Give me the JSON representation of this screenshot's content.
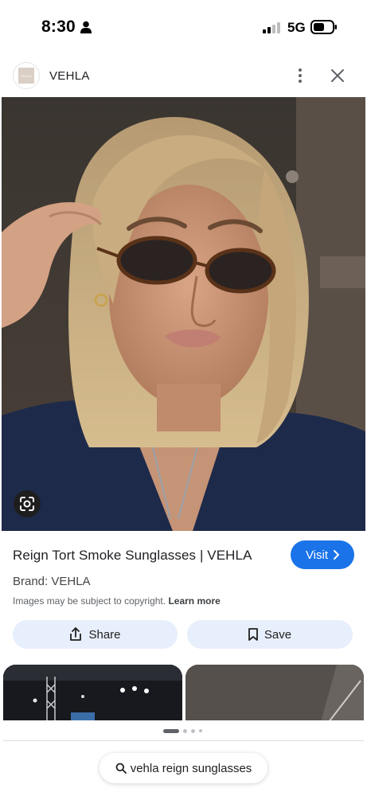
{
  "status_bar": {
    "time": "8:30",
    "network": "5G",
    "icons": [
      "person-icon",
      "signal-icon",
      "battery-icon"
    ]
  },
  "header": {
    "site_name": "VEHLA",
    "logo_text": "VEHLA",
    "icons": [
      "more-vertical-icon",
      "close-icon"
    ]
  },
  "image": {
    "lens_icon": "google-lens-icon"
  },
  "result": {
    "title": "Reign Tort Smoke Sunglasses | VEHLA",
    "visit_label": "Visit",
    "brand": "Brand: VEHLA",
    "copyright_text": "Images may be subject to copyright.",
    "learn_more": "Learn more"
  },
  "actions": {
    "share_label": "Share",
    "save_label": "Save"
  },
  "pagination": {
    "active_index": 0,
    "dot_count": 4
  },
  "search_chip": {
    "query": "vehla reign sunglasses"
  },
  "colors": {
    "accent": "#1a73e8",
    "pill_bg": "#e8effc",
    "text_primary": "#202124",
    "text_secondary": "#5f6368"
  }
}
